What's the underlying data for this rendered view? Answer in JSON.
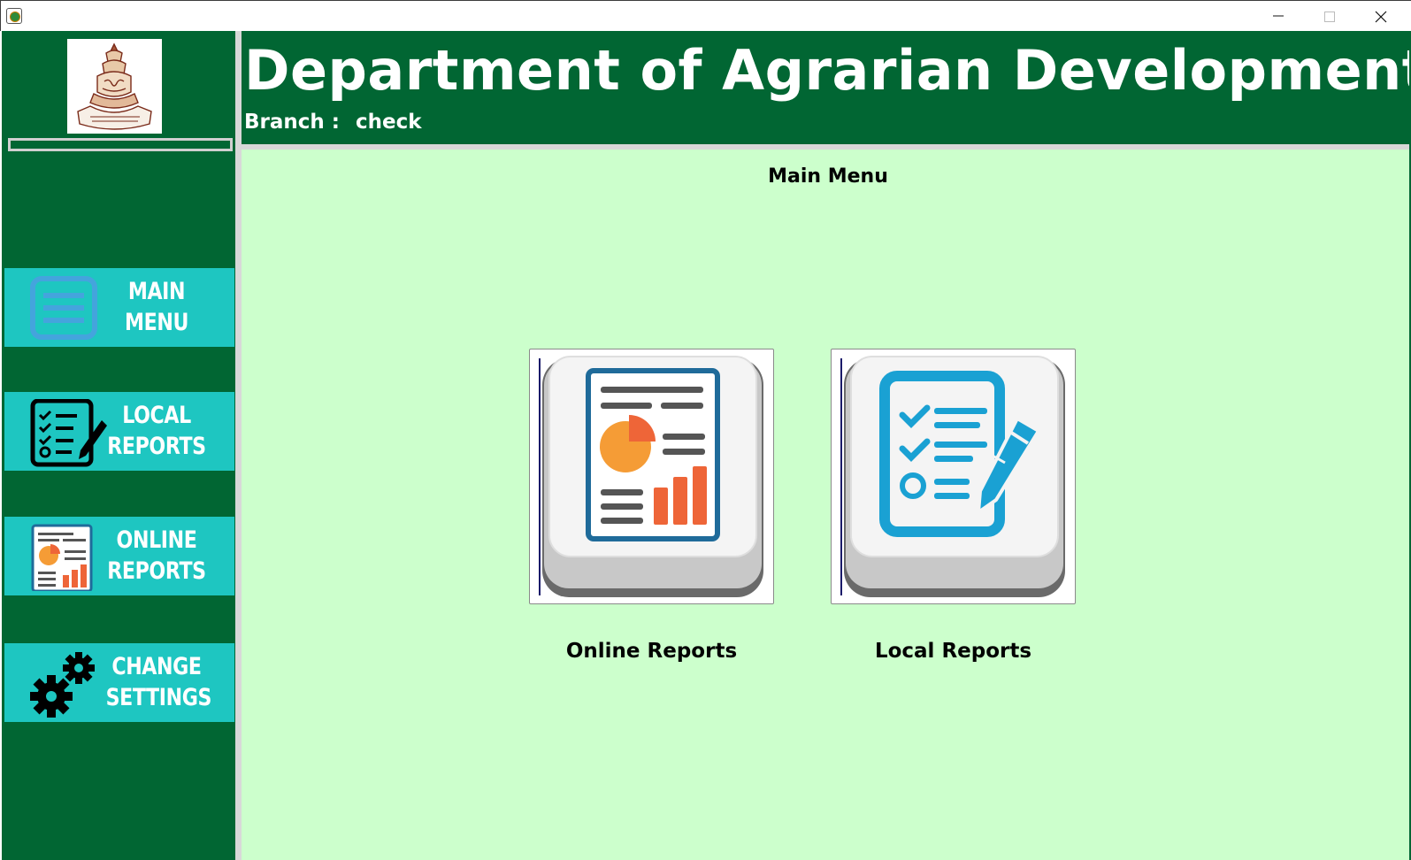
{
  "window": {
    "controls": {
      "minimize": "minimize-icon",
      "maximize": "maximize-icon",
      "close": "close-icon"
    }
  },
  "header": {
    "title": "Department of Agrarian Development",
    "branch_label": "Branch :",
    "branch_value": "check"
  },
  "sidebar": {
    "progress_fraction": 0,
    "items": [
      {
        "line1": "MAIN",
        "line2": "MENU",
        "icon": "menu-icon"
      },
      {
        "line1": "LOCAL",
        "line2": "REPORTS",
        "icon": "checklist-pencil-icon"
      },
      {
        "line1": "ONLINE",
        "line2": "REPORTS",
        "icon": "report-chart-icon"
      },
      {
        "line1": "CHANGE",
        "line2": "SETTINGS",
        "icon": "gears-icon"
      }
    ]
  },
  "main": {
    "title": "Main Menu",
    "tiles": [
      {
        "label": "Online Reports",
        "icon": "report-chart-icon"
      },
      {
        "label": "Local Reports",
        "icon": "checklist-pencil-icon"
      }
    ]
  },
  "colors": {
    "brand_green": "#016633",
    "content_bg": "#ccffcc",
    "nav_button": "#1ec6c1",
    "report_blue": "#1f6b9a",
    "chart_orange": "#f59c36",
    "chart_red": "#ee6538",
    "checklist_blue": "#1aa1d3"
  }
}
